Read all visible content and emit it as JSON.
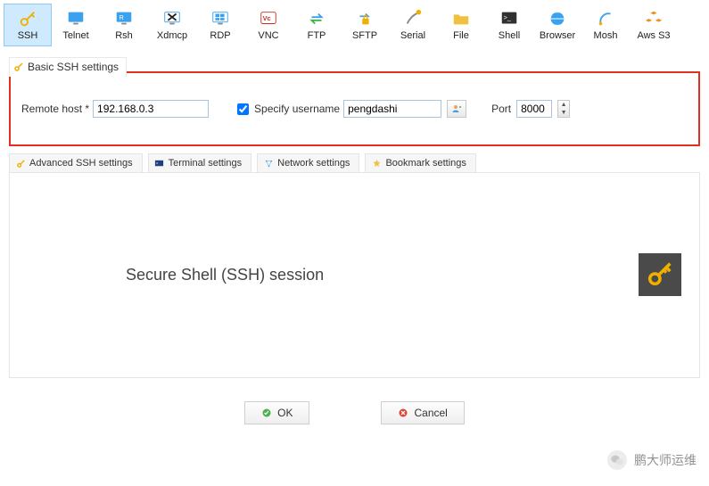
{
  "session_types": [
    {
      "id": "ssh",
      "label": "SSH",
      "selected": true
    },
    {
      "id": "telnet",
      "label": "Telnet"
    },
    {
      "id": "rsh",
      "label": "Rsh"
    },
    {
      "id": "xdmcp",
      "label": "Xdmcp"
    },
    {
      "id": "rdp",
      "label": "RDP"
    },
    {
      "id": "vnc",
      "label": "VNC"
    },
    {
      "id": "ftp",
      "label": "FTP"
    },
    {
      "id": "sftp",
      "label": "SFTP"
    },
    {
      "id": "serial",
      "label": "Serial"
    },
    {
      "id": "file",
      "label": "File"
    },
    {
      "id": "shell",
      "label": "Shell"
    },
    {
      "id": "browser",
      "label": "Browser"
    },
    {
      "id": "mosh",
      "label": "Mosh"
    },
    {
      "id": "awss3",
      "label": "Aws S3"
    }
  ],
  "basic": {
    "tab_label": "Basic SSH settings",
    "remote_host_label": "Remote host *",
    "remote_host": "192.168.0.3",
    "specify_username_label": "Specify username",
    "specify_username_checked": true,
    "username": "pengdashi",
    "port_label": "Port",
    "port": "8000"
  },
  "settings_tabs": [
    {
      "id": "adv",
      "label": "Advanced SSH settings"
    },
    {
      "id": "term",
      "label": "Terminal settings"
    },
    {
      "id": "net",
      "label": "Network settings"
    },
    {
      "id": "bm",
      "label": "Bookmark settings"
    }
  ],
  "main_title": "Secure Shell (SSH) session",
  "buttons": {
    "ok": "OK",
    "cancel": "Cancel"
  },
  "watermark": "鹏大师运维"
}
